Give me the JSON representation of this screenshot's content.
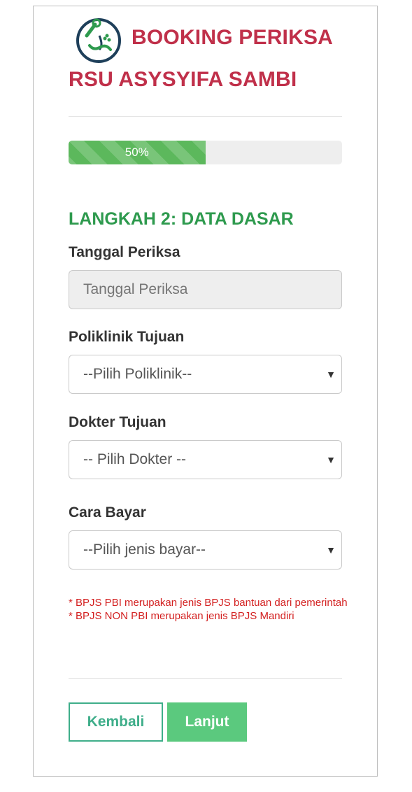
{
  "header": {
    "title_line1": "BOOKING PERIKSA",
    "title_line2": "RSU ASYSYIFA SAMBI",
    "logo_icon": "hospital-stethoscope-logo-icon"
  },
  "progress": {
    "percent": 50,
    "label": "50%"
  },
  "step": {
    "title": "LANGKAH 2: DATA DASAR"
  },
  "form": {
    "tanggal": {
      "label": "Tanggal Periksa",
      "placeholder": "Tanggal Periksa"
    },
    "poliklinik": {
      "label": "Poliklinik Tujuan",
      "selected": "--Pilih Poliklinik--"
    },
    "dokter": {
      "label": "Dokter Tujuan",
      "selected": "-- Pilih Dokter --"
    },
    "cara_bayar": {
      "label": "Cara Bayar",
      "selected": "--Pilih jenis bayar--"
    }
  },
  "notes": {
    "line1": "* BPJS PBI merupakan jenis BPJS bantuan dari pemerintah",
    "line2": "* BPJS NON PBI merupakan jenis BPJS Mandiri"
  },
  "buttons": {
    "back_label": "Kembali",
    "next_label": "Lanjut"
  },
  "colors": {
    "brand_red": "#c0304a",
    "success_green": "#5cb85c",
    "step_green": "#2e9a4e",
    "note_red": "#d32020"
  }
}
